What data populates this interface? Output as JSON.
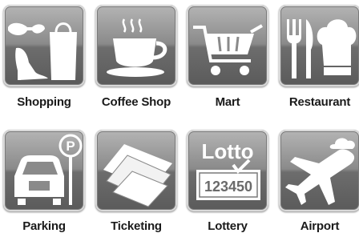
{
  "icons": [
    {
      "label": "Shopping",
      "icon": "shopping-icon"
    },
    {
      "label": "Coffee Shop",
      "icon": "coffee-cup-icon"
    },
    {
      "label": "Mart",
      "icon": "shopping-cart-icon"
    },
    {
      "label": "Restaurant",
      "icon": "chef-hat-cutlery-icon"
    },
    {
      "label": "Parking",
      "icon": "car-parking-icon"
    },
    {
      "label": "Ticketing",
      "icon": "tickets-icon"
    },
    {
      "label": "Lottery",
      "icon": "lotto-ticket-icon",
      "lotto_text": "Lotto",
      "lotto_number": "123450"
    },
    {
      "label": "Airport",
      "icon": "airplane-icon"
    }
  ]
}
